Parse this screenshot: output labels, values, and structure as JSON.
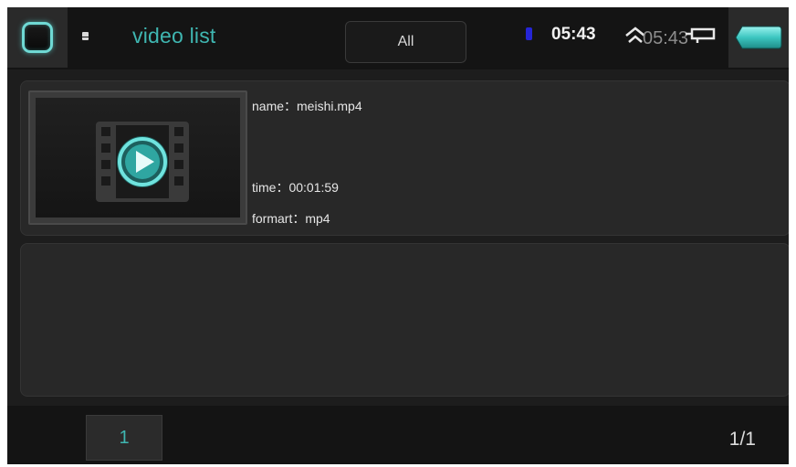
{
  "header": {
    "title": "video list",
    "filter_label": "All",
    "clock": "05:43",
    "clock_ghost": "05:43",
    "home_icon": "home-icon",
    "back_icon": "back-icon",
    "accent_color": "#3fb6b1"
  },
  "videos": [
    {
      "name_label": "name：meishi.mp4",
      "time_label": "time：00:01:59",
      "format_label": "formart：mp4",
      "thumbnail_icon": "video-file-play-icon"
    }
  ],
  "footer": {
    "page_button": "1",
    "page_indicator": "1/1"
  }
}
